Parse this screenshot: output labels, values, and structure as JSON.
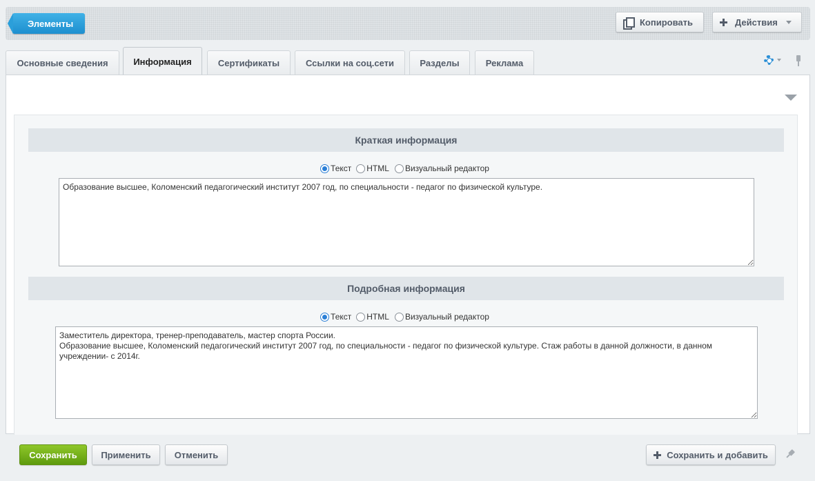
{
  "toolbar": {
    "elements_label": "Элементы",
    "copy_label": "Копировать",
    "actions_label": "Действия"
  },
  "tabs": [
    {
      "label": "Основные сведения",
      "active": false
    },
    {
      "label": "Информация",
      "active": true
    },
    {
      "label": "Сертификаты",
      "active": false
    },
    {
      "label": "Ссылки на соц.сети",
      "active": false
    },
    {
      "label": "Разделы",
      "active": false
    },
    {
      "label": "Реклама",
      "active": false
    }
  ],
  "icons": {
    "settings": "gear-icon",
    "pin": "pin-icon",
    "collapse": "triangle-down-icon",
    "copy": "copy-icon",
    "add": "plus-icon"
  },
  "format_options": {
    "text": "Текст",
    "html": "HTML",
    "visual": "Визуальный редактор"
  },
  "short_info": {
    "title": "Краткая информация",
    "selected_format": "text",
    "value": "Образование высшее, Коломенский педагогический институт 2007 год, по специальности - педагог по физической культуре."
  },
  "detail_info": {
    "title": "Подробная информация",
    "selected_format": "text",
    "value": "Заместитель директора, тренер-преподаватель, мастер спорта России.\nОбразование высшее, Коломенский педагогический институт 2007 год, по специальности - педагог по физической культуре. Стаж работы в данной должности, в данном учреждении- с 2014г."
  },
  "footer": {
    "save_label": "Сохранить",
    "apply_label": "Применить",
    "cancel_label": "Отменить",
    "save_add_label": "Сохранить и добавить"
  },
  "colors": {
    "primary_blue": "#2b9fda",
    "save_green": "#7cb51e",
    "section_header_bg": "#e0e5e9"
  }
}
